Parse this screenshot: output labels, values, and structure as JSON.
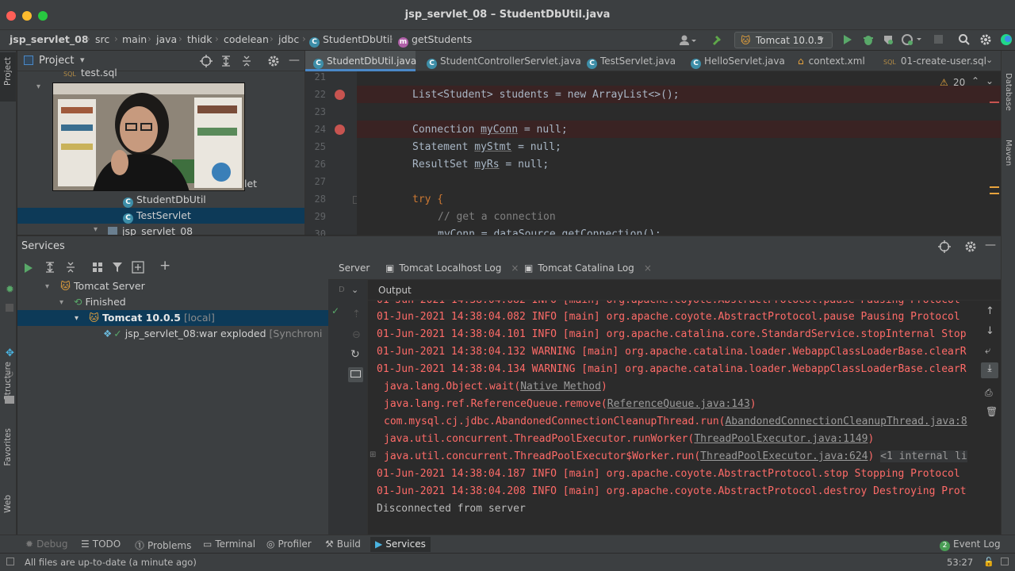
{
  "window": {
    "title": "jsp_servlet_08 – StudentDbUtil.java"
  },
  "breadcrumbs": [
    "jsp_servlet_08",
    "src",
    "main",
    "java",
    "thidk",
    "codelean",
    "jdbc",
    "StudentDbUtil",
    "getStudents"
  ],
  "run_config": {
    "name": "Tomcat 10.0.5"
  },
  "project_panel": {
    "title": "Project",
    "items": [
      {
        "label": "test.sql"
      },
      {
        "label": "let"
      },
      {
        "label": "StudentDbUtil"
      },
      {
        "label": "TestServlet"
      },
      {
        "label": "jsp_servlet_08"
      }
    ]
  },
  "editor": {
    "tabs": [
      {
        "label": "StudentDbUtil.java"
      },
      {
        "label": "StudentControllerServlet.java"
      },
      {
        "label": "TestServlet.java"
      },
      {
        "label": "HelloServlet.java"
      },
      {
        "label": "context.xml"
      },
      {
        "label": "01-create-user.sql"
      }
    ],
    "warning_count": "20",
    "line_numbers": [
      "21",
      "22",
      "23",
      "24",
      "25",
      "26",
      "27",
      "28",
      "29",
      "30"
    ],
    "lines": {
      "l22": "List<Student> students = new ArrayList<>();",
      "l24_a": "Connection ",
      "l24_b": "myConn",
      "l24_c": " = null;",
      "l25_a": "Statement ",
      "l25_b": "myStmt",
      "l25_c": " = null;",
      "l26_a": "ResultSet ",
      "l26_b": "myRs",
      "l26_c": " = null;",
      "l28": "try {",
      "l29": "// get a connection",
      "l30": "myConn = dataSource.getConnection();"
    }
  },
  "services": {
    "title": "Services",
    "tree": {
      "server": "Tomcat Server",
      "group": "Finished",
      "instance": "Tomcat 10.0.5",
      "instance_suffix": "[local]",
      "artifact": "jsp_servlet_08:war exploded",
      "artifact_suffix": "[Synchroni"
    },
    "tabs": [
      {
        "label": "Server"
      },
      {
        "label": "Tomcat Localhost Log"
      },
      {
        "label": "Tomcat Catalina Log"
      }
    ],
    "output_label": "Output",
    "log_lines": [
      "01-Jun-2021 14:38:04.082 INFO [main] org.apache.coyote.AbstractProtocol.pause Pausing Protocol",
      "01-Jun-2021 14:38:04.101 INFO [main] org.apache.catalina.core.StandardService.stopInternal Stop",
      "01-Jun-2021 14:38:04.132 WARNING [main] org.apache.catalina.loader.WebappClassLoaderBase.clearR",
      "01-Jun-2021 14:38:04.134 WARNING [main] org.apache.catalina.loader.WebappClassLoaderBase.clearR",
      "01-Jun-2021 14:38:04.187 INFO [main] org.apache.coyote.AbstractProtocol.stop Stopping Protocol",
      "01-Jun-2021 14:38:04.208 INFO [main] org.apache.coyote.AbstractProtocol.destroy Destroying Prot"
    ],
    "stack": [
      {
        "text": "java.lang.Object.wait(",
        "link": "Native Method",
        "end": ")"
      },
      {
        "text": "java.lang.ref.ReferenceQueue.remove(",
        "link": "ReferenceQueue.java:143",
        "end": ")"
      },
      {
        "text": "com.mysql.cj.jdbc.AbandonedConnectionCleanupThread.run(",
        "link": "AbandonedConnectionCleanupThread.java:8",
        "end": ""
      },
      {
        "text": "java.util.concurrent.ThreadPoolExecutor.runWorker(",
        "link": "ThreadPoolExecutor.java:1149",
        "end": ")"
      },
      {
        "text": "java.util.concurrent.ThreadPoolExecutor$Worker.run(",
        "link": "ThreadPoolExecutor.java:624",
        "end": ")"
      }
    ],
    "internal_note": "<1 internal li",
    "disconnected": "Disconnected from server"
  },
  "bottom_tools": [
    {
      "label": "Debug"
    },
    {
      "label": "TODO"
    },
    {
      "label": "Problems"
    },
    {
      "label": "Terminal"
    },
    {
      "label": "Profiler"
    },
    {
      "label": "Build"
    },
    {
      "label": "Services"
    }
  ],
  "event_log": {
    "label": "Event Log",
    "count": "2"
  },
  "status": {
    "message": "All files are up-to-date (a minute ago)",
    "position": "53:27"
  },
  "side_labels": {
    "project": "Project",
    "structure": "Structure",
    "favorites": "Favorites",
    "web": "Web",
    "database": "Database",
    "maven": "Maven"
  },
  "colors": {
    "accent": "#4a88c7",
    "error": "#ff6b68",
    "breakpoint": "#c75450",
    "selection": "#0d3a58",
    "keyword": "#cc7832"
  }
}
